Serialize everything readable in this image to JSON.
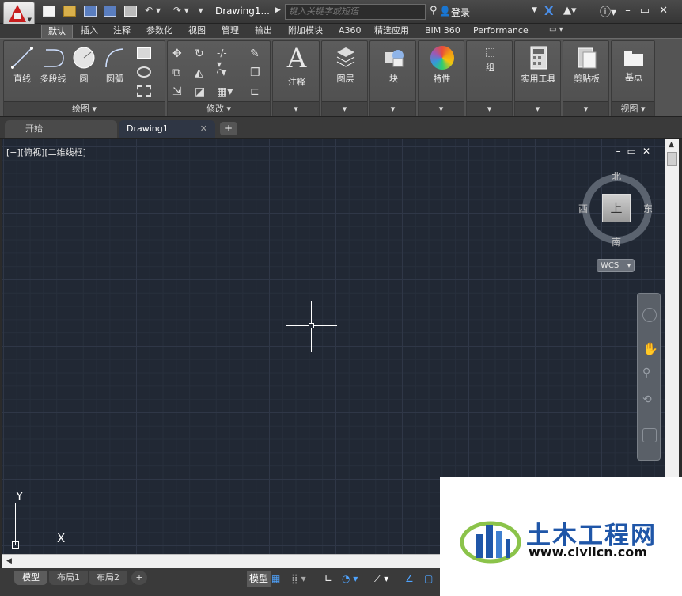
{
  "titlebar": {
    "app_menu_icon": "autocad-a-icon",
    "doc_title": "Drawing1...",
    "search_placeholder": "键入关键字或短语",
    "login_label": "登录"
  },
  "ribbon_tabs": [
    "默认",
    "插入",
    "注释",
    "参数化",
    "视图",
    "管理",
    "输出",
    "附加模块",
    "A360",
    "精选应用",
    "BIM 360",
    "Performance"
  ],
  "ribbon": {
    "draw": {
      "tools": [
        "直线",
        "多段线",
        "圆",
        "圆弧"
      ],
      "footer": "绘图 ▾"
    },
    "modify": {
      "footer": "修改 ▾"
    },
    "annotate": {
      "label": "注释"
    },
    "layers": {
      "label": "图层"
    },
    "block": {
      "label": "块"
    },
    "properties": {
      "label": "特性"
    },
    "group": {
      "label": "组"
    },
    "utilities": {
      "label": "实用工具"
    },
    "clipboard": {
      "label": "剪贴板"
    },
    "base": {
      "label": "基点",
      "footer": "视图 ▾"
    }
  },
  "doc_tabs": {
    "start": "开始",
    "drawing": "Drawing1"
  },
  "viewport": {
    "label": "[−][俯视][二维线框]",
    "viewcube": {
      "face": "上",
      "north": "北",
      "south": "南",
      "east": "东",
      "west": "西"
    },
    "wcs": "WCS"
  },
  "ucs": {
    "x": "X",
    "y": "Y"
  },
  "layout_tabs": [
    "模型",
    "布局1",
    "布局2"
  ],
  "status": {
    "model": "模型"
  },
  "watermark": {
    "title": "土木工程网",
    "url": "www.civilcn.com"
  }
}
